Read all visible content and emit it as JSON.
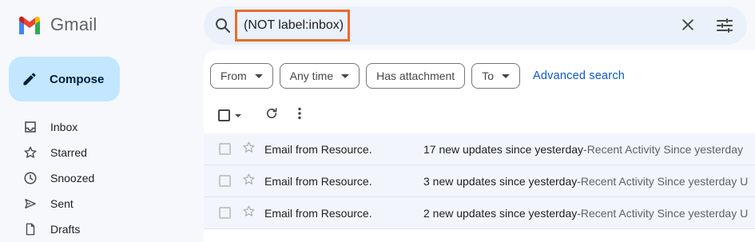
{
  "app": {
    "name": "Gmail"
  },
  "compose": {
    "label": "Compose"
  },
  "nav": {
    "items": [
      {
        "label": "Inbox",
        "icon": "inbox-icon"
      },
      {
        "label": "Starred",
        "icon": "star-icon"
      },
      {
        "label": "Snoozed",
        "icon": "clock-icon"
      },
      {
        "label": "Sent",
        "icon": "send-icon"
      },
      {
        "label": "Drafts",
        "icon": "draft-icon"
      }
    ]
  },
  "search": {
    "query": "(NOT label:inbox)"
  },
  "filters": {
    "chips": [
      {
        "label": "From",
        "dropdown": true
      },
      {
        "label": "Any time",
        "dropdown": true
      },
      {
        "label": "Has attachment",
        "dropdown": false
      },
      {
        "label": "To",
        "dropdown": true
      }
    ],
    "advanced_label": "Advanced search"
  },
  "emails": [
    {
      "sender": "Email from Resource.",
      "subject": "17 new updates since yesterday",
      "separator": " - ",
      "snippet": "Recent Activity Since yesterday"
    },
    {
      "sender": "Email from Resource.",
      "subject": "3 new updates since yesterday",
      "separator": " - ",
      "snippet": "Recent Activity Since yesterday U"
    },
    {
      "sender": "Email from Resource.",
      "subject": "2 new updates since yesterday",
      "separator": " - ",
      "snippet": "Recent Activity Since yesterday U"
    }
  ],
  "colors": {
    "accent": "#0b57d0",
    "compose_bg": "#c2e7ff",
    "highlight_box": "#ea6a2b"
  }
}
